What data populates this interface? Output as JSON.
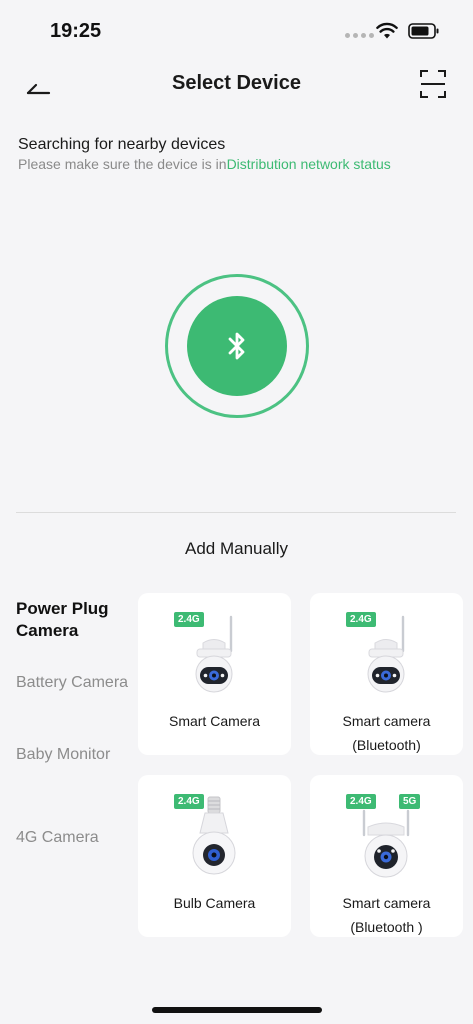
{
  "status_bar": {
    "time": "19:25"
  },
  "nav": {
    "title": "Select Device"
  },
  "search": {
    "title": "Searching for nearby devices",
    "hint_prefix": "Please make sure the device is in",
    "hint_link": "Distribution network status"
  },
  "manual": {
    "title": "Add Manually"
  },
  "categories": [
    {
      "label": "Power Plug Camera",
      "active": true
    },
    {
      "label": "Battery Camera",
      "active": false
    },
    {
      "label": "Baby Monitor",
      "active": false
    },
    {
      "label": "4G Camera",
      "active": false
    }
  ],
  "devices": [
    {
      "name": "Smart Camera",
      "tags": [
        "2.4G"
      ]
    },
    {
      "name": "Smart camera (Bluetooth)",
      "tags": [
        "2.4G"
      ]
    },
    {
      "name": "Bulb Camera",
      "tags": [
        "2.4G"
      ]
    },
    {
      "name": "Smart camera (Bluetooth )",
      "tags": [
        "2.4G",
        "5G"
      ]
    }
  ],
  "colors": {
    "accent": "#3dba73",
    "background": "#f5f5f7",
    "card": "#ffffff"
  },
  "icons": {
    "back": "arrow-left-icon",
    "scan": "scan-icon",
    "bluetooth": "bluetooth-icon",
    "wifi": "wifi-icon",
    "battery": "battery-icon"
  }
}
